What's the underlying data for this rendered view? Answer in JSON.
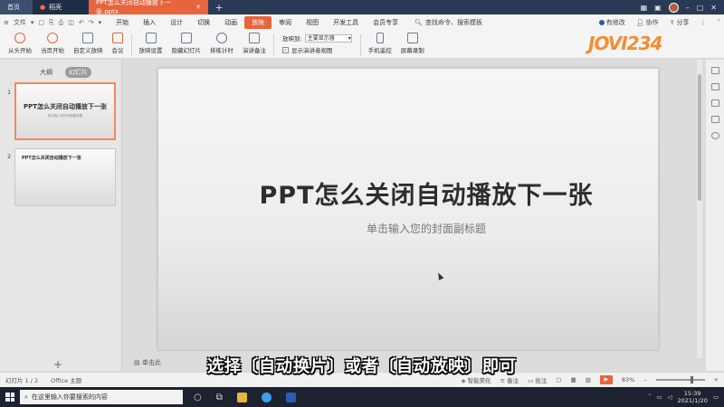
{
  "tabs": {
    "home": "首页",
    "doc": "稻壳",
    "active_file": "PPT怎么关闭自动播放下一张.pptx",
    "new_tab": "+"
  },
  "menu": {
    "file": "文件",
    "items": [
      "开始",
      "插入",
      "设计",
      "切换",
      "动画",
      "放映",
      "审阅",
      "视图",
      "开发工具",
      "会员专享"
    ],
    "active_index": 5,
    "search": "查找命令、搜索模板",
    "right": [
      "有修改",
      "协作",
      "分享"
    ]
  },
  "ribbon": {
    "from_start": "从头开始",
    "from_current": "当页开始",
    "custom_show": "自定义放映",
    "meeting": "会议",
    "setup": "放映设置",
    "hide_slide": "隐藏幻灯片",
    "rehearse": "排练计时",
    "presenter_notes": "演讲备注",
    "show_to_label": "放映到:",
    "show_to_value": "主要显示器",
    "presenter_view": "显示演讲者视图",
    "phone_remote": "手机遥控",
    "screen_record": "屏幕录制"
  },
  "logo_text": "JOVI234",
  "left_panel": {
    "outline_tab": "大纲",
    "slides_tab": "幻灯片",
    "thumbs": [
      {
        "num": "1",
        "title": "PPT怎么关闭自动播放下一张",
        "subtitle": "单击输入您的封面副标题"
      },
      {
        "num": "2",
        "title": "PPT怎么关闭自动播放下一张"
      }
    ]
  },
  "slide": {
    "title": "PPT怎么关闭自动播放下一张",
    "subtitle": "单击输入您的封面副标题"
  },
  "notes_placeholder": "单击此",
  "status": {
    "slide_count": "幻灯片 1 / 2",
    "theme": "Office 主题",
    "smart": "智能美化",
    "notes": "备注",
    "comments": "批注",
    "zoom": "83%"
  },
  "caption": "选择〔自动换片〕或者〔自动放映〕即可",
  "taskbar": {
    "search_placeholder": "在这里输入你要搜索的内容",
    "time": "15:39",
    "date": "2021/1/20"
  }
}
